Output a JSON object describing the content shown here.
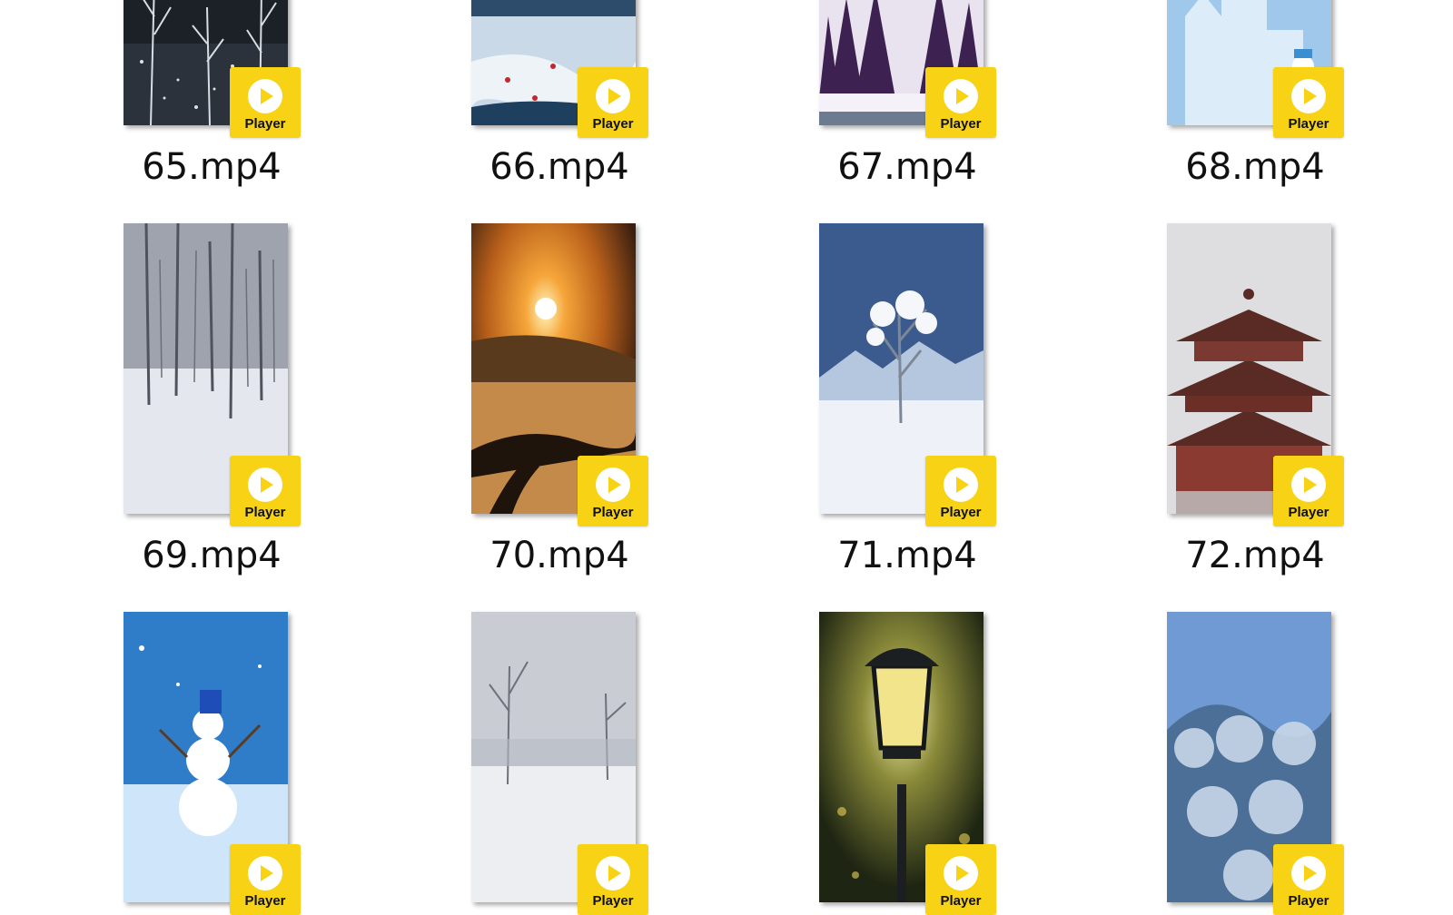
{
  "window": {
    "background": "#ffffff"
  },
  "badge": {
    "label": "Player",
    "color": "#f7d215",
    "icon": "play-circle-icon"
  },
  "files": [
    {
      "name": "65.mp4",
      "theme": "dark-snow-forest"
    },
    {
      "name": "66.mp4",
      "theme": "snowy-stream-red-leaves"
    },
    {
      "name": "67.mp4",
      "theme": "purple-pine-forest"
    },
    {
      "name": "68.mp4",
      "theme": "ice-castle-snowman"
    },
    {
      "name": "69.mp4",
      "theme": "misty-snow-forest"
    },
    {
      "name": "70.mp4",
      "theme": "sunset-snow-field"
    },
    {
      "name": "71.mp4",
      "theme": "frosted-tree-mountains"
    },
    {
      "name": "72.mp4",
      "theme": "snowy-pagoda"
    },
    {
      "name": "",
      "theme": "snowman-blue-sky"
    },
    {
      "name": "",
      "theme": "foggy-snow-trees"
    },
    {
      "name": "",
      "theme": "street-lamp-night"
    },
    {
      "name": "",
      "theme": "frosted-shrubs"
    }
  ]
}
